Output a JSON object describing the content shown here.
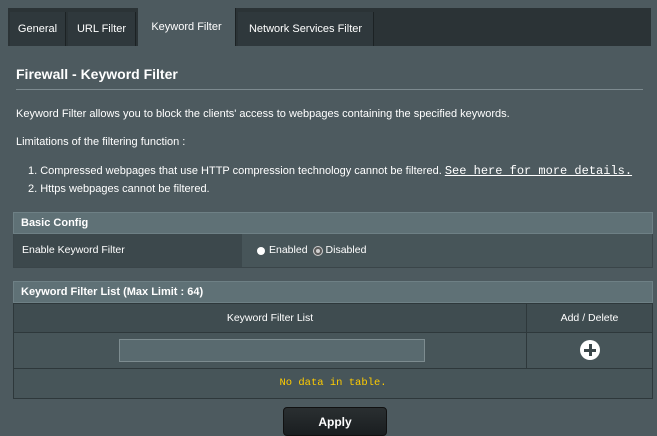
{
  "tabs": [
    {
      "label": "General"
    },
    {
      "label": "URL Filter"
    },
    {
      "label": "Keyword Filter",
      "active": true
    },
    {
      "label": "Network Services Filter"
    }
  ],
  "page": {
    "title": "Firewall - Keyword Filter",
    "description": "Keyword Filter allows you to block the clients' access to webpages containing the specified keywords.",
    "limitations_heading": "Limitations of the filtering function :",
    "limitations": [
      {
        "text": "1. Compressed webpages that use HTTP compression technology cannot be filtered.",
        "link": "See here for more details."
      },
      {
        "text": "2. Https webpages cannot be filtered."
      }
    ]
  },
  "basic_config": {
    "heading": "Basic Config",
    "enable_label": "Enable Keyword Filter",
    "options": [
      "Enabled",
      "Disabled"
    ],
    "selected": "Enabled"
  },
  "keyword_list": {
    "heading": "Keyword Filter List (Max Limit : 64)",
    "col_list": "Keyword Filter List",
    "col_action": "Add / Delete",
    "input_value": "",
    "add_icon": "plus-circle-icon",
    "empty_text": "No data in table."
  },
  "apply_label": "Apply",
  "colors": {
    "background": "#4d5a5f",
    "tab_bar": "#2b3336",
    "section_header": "#5f7176",
    "empty_text": "#ffcc00"
  }
}
